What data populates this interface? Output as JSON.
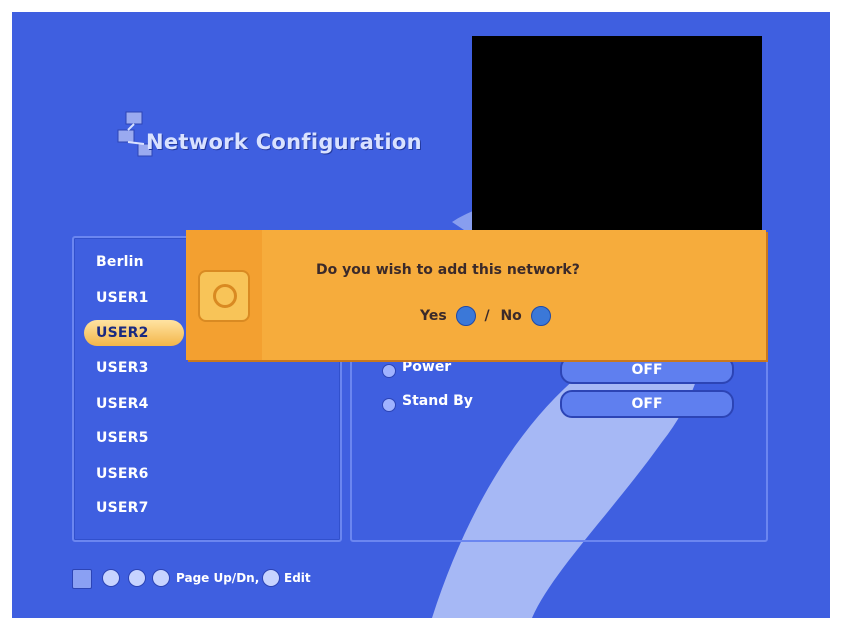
{
  "screen": {
    "title": "Network Configuration",
    "background_color": "#3f5fe0",
    "accent_color": "#f6ac3c"
  },
  "network_list": {
    "items": [
      "Berlin",
      "USER1",
      "USER2",
      "USER3",
      "USER4",
      "USER5",
      "USER6",
      "USER7"
    ],
    "selected": "USER2"
  },
  "settings": {
    "rows": [
      {
        "label": "Power",
        "value": "OFF"
      },
      {
        "label": "Stand By",
        "value": "OFF"
      }
    ]
  },
  "dialog": {
    "question": "Do you wish to add this network?",
    "yes_label": "Yes",
    "separator": "/",
    "no_label": "No",
    "yes_key_icon": "ok-button-icon",
    "no_key_icon": "info-button-icon"
  },
  "footer": {
    "hint": "Page Up/Dn,",
    "hint_edit": "Edit",
    "icons": [
      "help-icon",
      "info-key-icon",
      "ok-key-icon",
      "exit-key-icon"
    ]
  }
}
